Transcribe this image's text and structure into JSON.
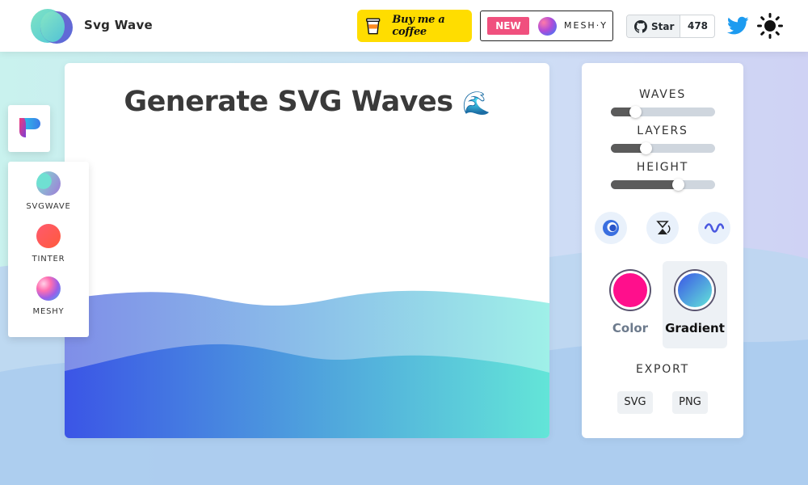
{
  "header": {
    "brand": "Svg Wave",
    "coffee_label": "Buy me a coffee",
    "promo": {
      "badge": "NEW",
      "name": "MESH·Y"
    },
    "github": {
      "star_label": "Star",
      "count": "478"
    },
    "icons": [
      "logo-icon",
      "coffee-cup-icon",
      "meshy-orb-icon",
      "github-icon",
      "twitter-icon",
      "sun-icon"
    ]
  },
  "dock": {
    "apps": [
      {
        "label": "SVGWAVE",
        "icon": "svgwave-icon"
      },
      {
        "label": "TINTER",
        "icon": "tinter-icon"
      },
      {
        "label": "MESHY",
        "icon": "meshy-icon"
      }
    ]
  },
  "canvas": {
    "title": "Generate SVG Waves",
    "title_emoji": "🌊",
    "gradient": {
      "start": "#3b55e6",
      "end": "#63e5d8"
    }
  },
  "controls": {
    "waves": {
      "label": "WAVES",
      "value": 0.24
    },
    "layers": {
      "label": "LAYERS",
      "value": 0.34
    },
    "height": {
      "label": "HEIGHT",
      "value": 0.65
    },
    "action_icons": [
      "randomize-icon",
      "flip-icon",
      "wave-shape-icon"
    ],
    "fill_options": [
      {
        "label": "Color",
        "color": "#ff0f8c",
        "selected": false
      },
      {
        "label": "Gradient",
        "gradient": [
          "#3b55e6",
          "#63e5d8"
        ],
        "selected": true
      }
    ],
    "export": {
      "label": "EXPORT",
      "buttons": [
        "SVG",
        "PNG"
      ]
    }
  },
  "colors": {
    "accent": "#ffdd00",
    "badge": "#f0507e",
    "panel_bg": "#ffffff"
  }
}
